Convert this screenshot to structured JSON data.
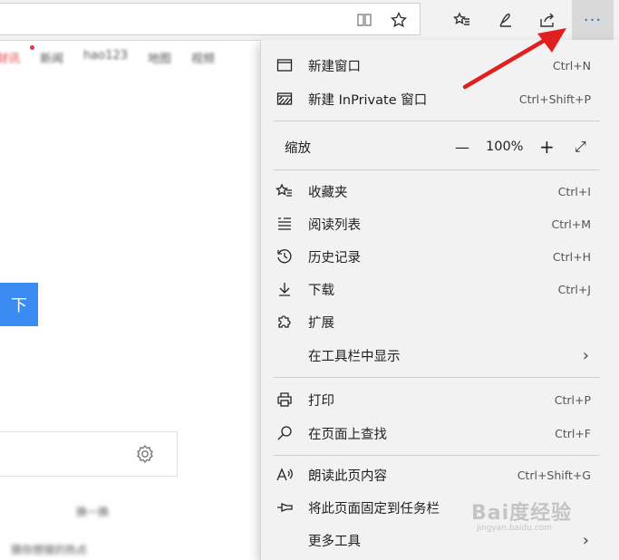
{
  "toolbar": {
    "icons": [
      "reading-view-icon",
      "favorite-star-icon",
      "favorites-hub-icon",
      "pen-icon",
      "share-icon"
    ],
    "more_label": "···"
  },
  "background_page": {
    "nav_links": [
      "财讯",
      "新闻",
      "hao123",
      "地图",
      "视频"
    ],
    "button_label": "下",
    "list_item_1": "换一换",
    "list_item_2": "猜你想搜的热点"
  },
  "menu": {
    "new_window": {
      "label": "新建窗口",
      "shortcut": "Ctrl+N"
    },
    "new_inprivate": {
      "label": "新建 InPrivate 窗口",
      "shortcut": "Ctrl+Shift+P"
    },
    "zoom": {
      "label": "缩放",
      "minus": "—",
      "value": "100%",
      "plus": "+",
      "expand": "⤢"
    },
    "favorites": {
      "label": "收藏夹",
      "shortcut": "Ctrl+I"
    },
    "reading_list": {
      "label": "阅读列表",
      "shortcut": "Ctrl+M"
    },
    "history": {
      "label": "历史记录",
      "shortcut": "Ctrl+H"
    },
    "downloads": {
      "label": "下载",
      "shortcut": "Ctrl+J"
    },
    "extensions": {
      "label": "扩展"
    },
    "show_in_toolbar": {
      "label": "在工具栏中显示",
      "chevron": "›"
    },
    "print": {
      "label": "打印",
      "shortcut": "Ctrl+P"
    },
    "find": {
      "label": "在页面上查找",
      "shortcut": "Ctrl+F"
    },
    "read_aloud": {
      "label": "朗读此页内容",
      "shortcut": "Ctrl+Shift+G"
    },
    "pin_taskbar": {
      "label": "将此页面固定到任务栏"
    },
    "more_tools": {
      "label": "更多工具",
      "chevron": "›"
    }
  },
  "watermark": {
    "brand": "Bai度经验",
    "url": "jingyan.baidu.com"
  },
  "colors": {
    "accent": "#1a73c9",
    "arrow": "#e02020",
    "button": "#3b8cf2"
  }
}
